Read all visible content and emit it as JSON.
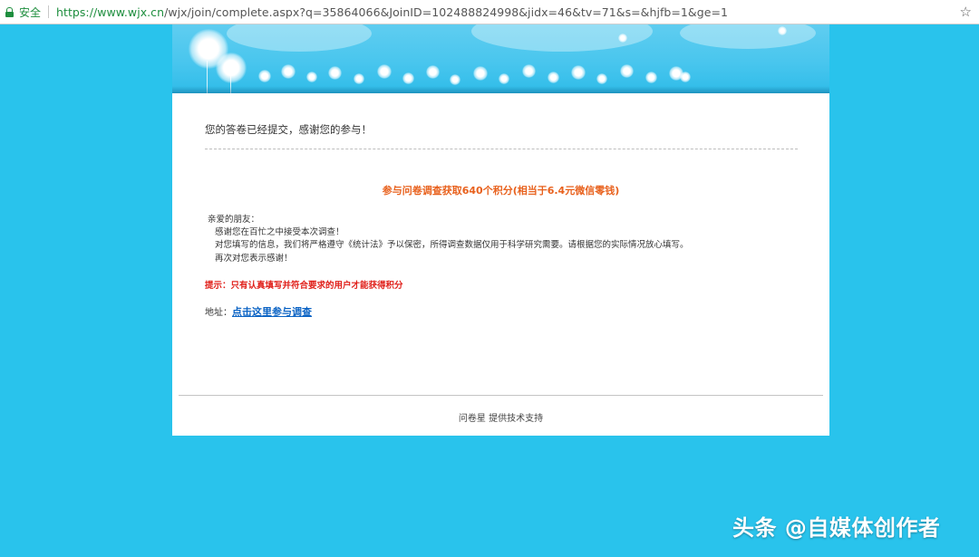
{
  "browser": {
    "secure_label": "安全",
    "url_host": "https://www.wjx.cn",
    "url_path": "/wjx/join/complete.aspx?q=35864066&JoinID=102488824998&jidx=46&tv=71&s=&hjfb=1&ge=1",
    "bookmark_icon": "star-icon"
  },
  "panel": {
    "thanks": "您的答卷已经提交，感谢您的参与！",
    "promo": "参与问卷调查获取640个积分(相当于6.4元微信零钱)",
    "greeting": "亲爱的朋友：",
    "line1": "感谢您在百忙之中接受本次调查！",
    "line2": "对您填写的信息，我们将严格遵守《统计法》予以保密，所得调查数据仅用于科学研究需要。请根据您的实际情况放心填写。",
    "line3": "再次对您表示感谢！",
    "tip": "提示：只有认真填写并符合要求的用户才能获得积分",
    "address_label": "地址：",
    "survey_link": "点击这里参与调查",
    "footer": "问卷星 提供技术支持"
  },
  "watermark": "头条 @自媒体创作者",
  "colors": {
    "background": "#29c3ec",
    "promo": "#e8611d",
    "tip": "#e0201a",
    "link": "#0b63c4",
    "secure": "#1e8e3e"
  }
}
